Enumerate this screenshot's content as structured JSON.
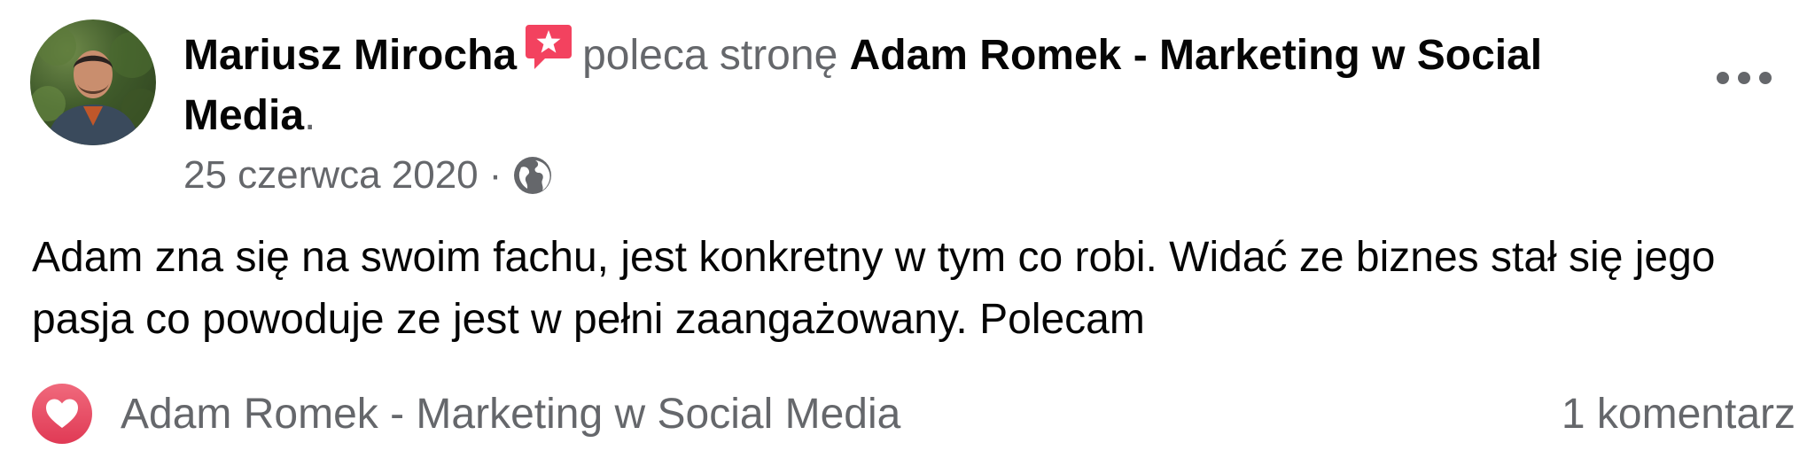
{
  "post": {
    "author_name": "Mariusz Mirocha",
    "verb": "poleca stronę",
    "page_name": "Adam Romek - Marketing w Social Media",
    "period": ".",
    "date": "25 czerwca 2020",
    "separator": "·",
    "privacy_icon": "globe-icon",
    "recommend_icon": "recommend-star-badge-icon",
    "more_icon": "more-horizontal-icon",
    "body": "Adam zna się na swoim fachu, jest konkretny w tym co robi. Widać ze biznes stał się jego pasja co powoduje ze jest w pełni zaangażowany. Polecam"
  },
  "footer": {
    "reaction_icon": "love-reaction-icon",
    "reactors": "Adam Romek - Marketing w Social Media",
    "comments": "1 komentarz"
  },
  "colors": {
    "primary_text": "#050505",
    "secondary_text": "#65676b",
    "badge": "#f3425f",
    "love_reaction": "#f33e58"
  }
}
